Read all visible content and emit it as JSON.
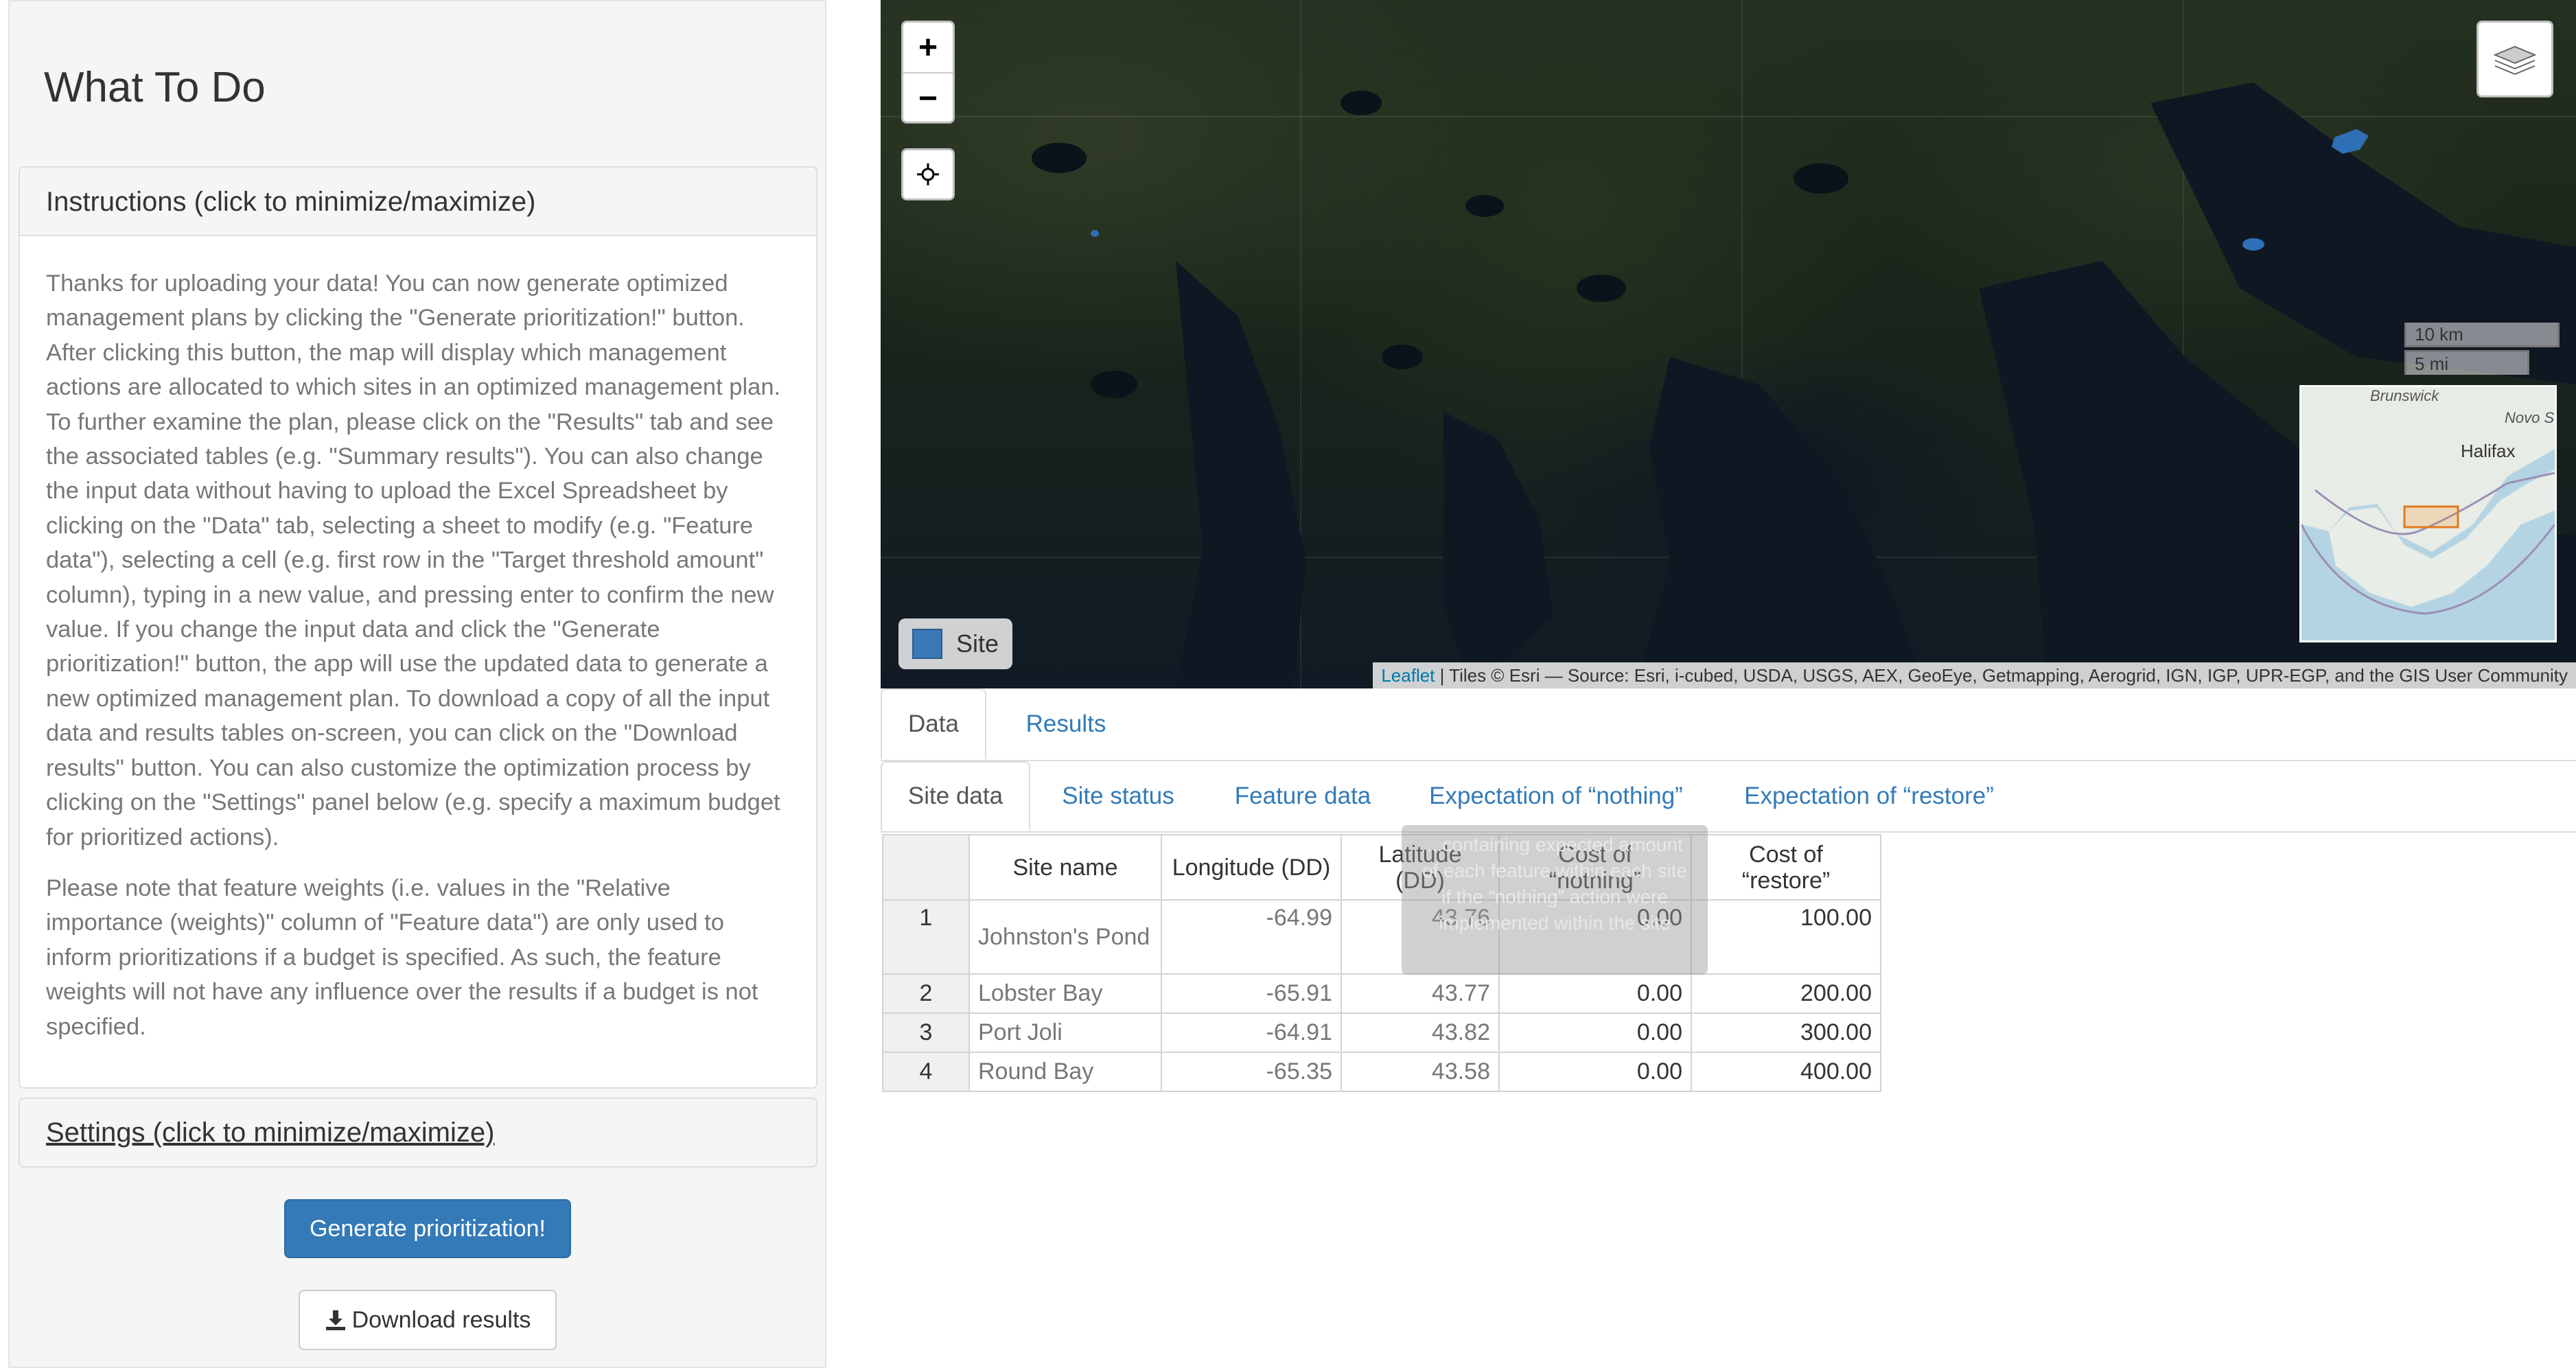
{
  "sidebar": {
    "title": "What To Do",
    "instructions": {
      "header": "Instructions (click to minimize/maximize)",
      "paragraph1": "Thanks for uploading your data! You can now generate optimized management plans by clicking the \"Generate prioritization!\" button. After clicking this button, the map will display which management actions are allocated to which sites in an optimized management plan. To further examine the plan, please click on the \"Results\" tab and see the associated tables (e.g. \"Summary results\"). You can also change the input data without having to upload the Excel Spreadsheet by clicking on the \"Data\" tab, selecting a sheet to modify (e.g. \"Feature data\"), selecting a cell (e.g. first row in the \"Target threshold amount\" column), typing in a new value, and pressing enter to confirm the new value. If you change the input data and click the \"Generate prioritization!\" button, the app will use the updated data to generate a new optimized management plan. To download a copy of all the input data and results tables on-screen, you can click on the \"Download results\" button. You can also customize the optimization process by clicking on the \"Settings\" panel below (e.g. specify a maximum budget for prioritized actions).",
      "paragraph2": "Please note that feature weights (i.e. values in the \"Relative importance (weights)\" column of \"Feature data\") are only used to inform prioritizations if a budget is specified. As such, the feature weights will not have any influence over the results if a budget is not specified."
    },
    "settings_header": "Settings (click to minimize/maximize)",
    "generate_label": "Generate prioritization!",
    "download_label": "Download results"
  },
  "map": {
    "zoom_in": "+",
    "zoom_out": "−",
    "scale_km": "10 km",
    "scale_mi": "5 mi",
    "minimap_labels": {
      "brunswick": "Brunswick",
      "novo": "Novo S",
      "halifax": "Halifax"
    },
    "legend_label": "Site",
    "legend_color": "#3a78b5",
    "attribution_link": "Leaflet",
    "attribution_text": " | Tiles © Esri — Source: Esri, i-cubed, USDA, USGS, AEX, GeoEye, Getmapping, Aerogrid, IGN, IGP, UPR-EGP, and the GIS User Community"
  },
  "tabs": {
    "main": [
      "Data",
      "Results"
    ],
    "sub": [
      "Site data",
      "Site status",
      "Feature data",
      "Expectation of “nothing”",
      "Expectation of “restore”"
    ]
  },
  "table": {
    "headers": [
      "Site name",
      "Longitude (DD)",
      "Latitude\n(DD)",
      "Cost of\n“nothing”",
      "Cost of\n“restore”"
    ],
    "rows": [
      {
        "n": "1",
        "name": "Johnston's Pond",
        "lon": "-64.99",
        "lat": "43.76",
        "c_nothing": "0.00",
        "c_restore": "100.00"
      },
      {
        "n": "2",
        "name": "Lobster Bay",
        "lon": "-65.91",
        "lat": "43.77",
        "c_nothing": "0.00",
        "c_restore": "200.00"
      },
      {
        "n": "3",
        "name": "Port Joli",
        "lon": "-64.91",
        "lat": "43.82",
        "c_nothing": "0.00",
        "c_restore": "300.00"
      },
      {
        "n": "4",
        "name": "Round Bay",
        "lon": "-65.35",
        "lat": "43.58",
        "c_nothing": "0.00",
        "c_restore": "400.00"
      }
    ]
  },
  "tooltip": "...containing expected amount of each feature within each site if the “nothing” action were implemented within the site"
}
